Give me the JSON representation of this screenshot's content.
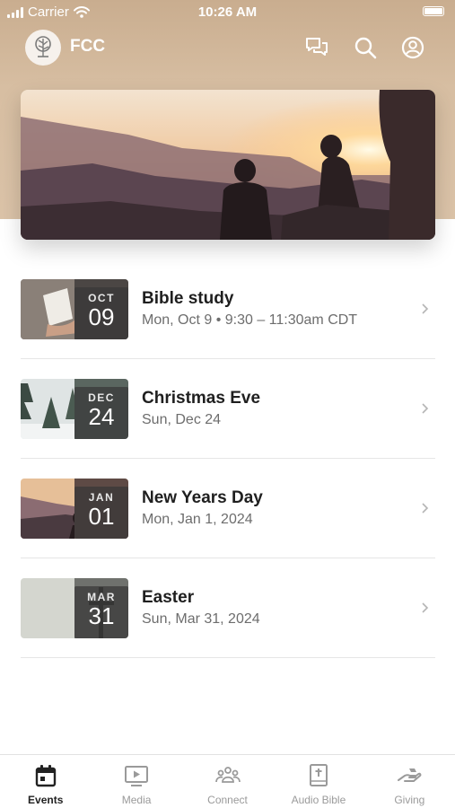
{
  "status_bar": {
    "carrier": "Carrier",
    "time": "10:26 AM"
  },
  "app": {
    "name": "FCC"
  },
  "icons": {
    "chat": "chat-bubbles-icon",
    "search": "search-icon",
    "profile": "profile-icon"
  },
  "events": [
    {
      "month": "OCT",
      "day": "09",
      "title": "Bible study",
      "subtitle": "Mon, Oct 9 • 9:30 – 11:30am CDT"
    },
    {
      "month": "DEC",
      "day": "24",
      "title": "Christmas Eve",
      "subtitle": "Sun, Dec 24"
    },
    {
      "month": "JAN",
      "day": "01",
      "title": "New Years Day",
      "subtitle": "Mon, Jan 1, 2024"
    },
    {
      "month": "MAR",
      "day": "31",
      "title": "Easter",
      "subtitle": "Sun, Mar 31, 2024"
    }
  ],
  "tabs": [
    {
      "label": "Events",
      "active": true
    },
    {
      "label": "Media",
      "active": false
    },
    {
      "label": "Connect",
      "active": false
    },
    {
      "label": "Audio Bible",
      "active": false
    },
    {
      "label": "Giving",
      "active": false
    }
  ],
  "colors": {
    "header": "#d3b898",
    "active_tab": "#222222",
    "inactive_tab": "#9a9a9a"
  }
}
